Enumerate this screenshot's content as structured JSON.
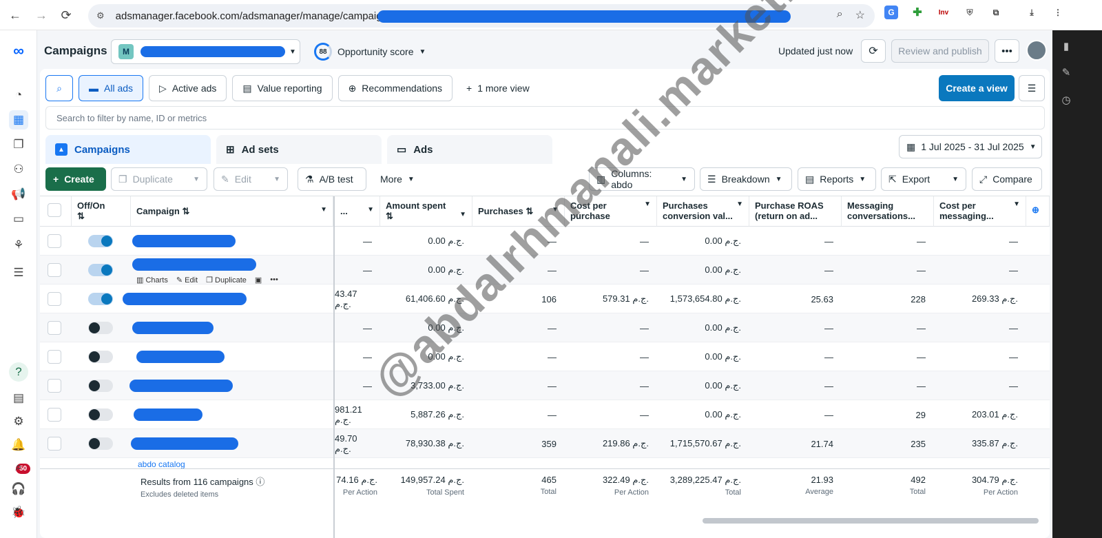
{
  "browser": {
    "url": "adsmanager.facebook.com/adsmanager/manage/campaigns"
  },
  "header": {
    "title": "Campaigns",
    "account_initial": "M",
    "opportunity_score": "88",
    "opportunity_label": "Opportunity score",
    "updated": "Updated just now",
    "review_publish": "Review and publish"
  },
  "views": {
    "all_ads": "All ads",
    "active_ads": "Active ads",
    "value_reporting": "Value reporting",
    "recommendations": "Recommendations",
    "more_view": "1 more view",
    "create_view": "Create a view"
  },
  "filter_placeholder": "Search to filter by name, ID or metrics",
  "tabs": {
    "campaigns": "Campaigns",
    "adsets": "Ad sets",
    "ads": "Ads"
  },
  "date_range": "1 Jul 2025 - 31 Jul 2025",
  "toolbar": {
    "create": "Create",
    "duplicate": "Duplicate",
    "edit": "Edit",
    "ab_test": "A/B test",
    "more": "More",
    "columns": "Columns: abdo",
    "breakdown": "Breakdown",
    "reports": "Reports",
    "export": "Export",
    "compare": "Compare"
  },
  "table": {
    "headers": {
      "offon": "Off/On",
      "campaign": "Campaign",
      "amount_spent": "Amount spent",
      "purchases": "Purchases",
      "cost_per_purchase": "Cost per purchase",
      "purchases_conv_value": "Purchases conversion val...",
      "purchase_roas": "Purchase ROAS (return on ad...",
      "messaging_conv": "Messaging conversations...",
      "cost_per_messaging": "Cost per messaging..."
    },
    "row_actions": {
      "charts": "Charts",
      "edit": "Edit",
      "duplicate": "Duplicate"
    },
    "rows": [
      {
        "on": true,
        "partial": "—",
        "spent": "0.00 ج.م.",
        "purchases": "—",
        "cpp": "—",
        "pcv": "0.00 ج.م.",
        "roas": "—",
        "msg": "—",
        "cpm": "—"
      },
      {
        "on": true,
        "partial": "—",
        "spent": "0.00 ج.م.",
        "purchases": "—",
        "cpp": "—",
        "pcv": "0.00 ج.م.",
        "roas": "—",
        "msg": "—",
        "cpm": "—"
      },
      {
        "on": true,
        "partial": "43.47 ج.م.",
        "spent": "61,406.60 ج.م.",
        "purchases": "106",
        "cpp": "579.31 ج.م.",
        "pcv": "1,573,654.80 ج.م.",
        "roas": "25.63",
        "msg": "228",
        "cpm": "269.33 ج.م."
      },
      {
        "on": false,
        "partial": "—",
        "spent": "0.00 ج.م.",
        "purchases": "—",
        "cpp": "—",
        "pcv": "0.00 ج.م.",
        "roas": "—",
        "msg": "—",
        "cpm": "—"
      },
      {
        "on": false,
        "partial": "—",
        "spent": "0.00 ج.م.",
        "purchases": "—",
        "cpp": "—",
        "pcv": "0.00 ج.م.",
        "roas": "—",
        "msg": "—",
        "cpm": "—"
      },
      {
        "on": false,
        "partial": "—",
        "spent": "3,733.00 ج.م.",
        "purchases": "—",
        "cpp": "—",
        "pcv": "0.00 ج.م.",
        "roas": "—",
        "msg": "—",
        "cpm": "—"
      },
      {
        "on": false,
        "partial": "981.21 ج.م.",
        "spent": "5,887.26 ج.م.",
        "purchases": "—",
        "cpp": "—",
        "pcv": "0.00 ج.م.",
        "roas": "—",
        "msg": "29",
        "cpm": "203.01 ج.م."
      },
      {
        "on": false,
        "partial": "49.70 ج.م.",
        "spent": "78,930.38 ج.م.",
        "purchases": "359",
        "cpp": "219.86 ج.م.",
        "pcv": "1,715,570.67 ج.م.",
        "roas": "21.74",
        "msg": "235",
        "cpm": "335.87 ج.م."
      }
    ],
    "partial_row_name": "abdo catalog",
    "totals": {
      "label": "Results from 116 campaigns",
      "sub": "Excludes deleted items",
      "partial": "74.16 ج.م.",
      "partial_sub": "Per Action",
      "spent": "149,957.24 ج.م.",
      "spent_sub": "Total Spent",
      "purchases": "465",
      "purchases_sub": "Total",
      "cpp": "322.49 ج.م.",
      "cpp_sub": "Per Action",
      "pcv": "3,289,225.47 ج.م.",
      "pcv_sub": "Total",
      "roas": "21.93",
      "roas_sub": "Average",
      "msg": "492",
      "msg_sub": "Total",
      "cpm": "304.79 ج.م.",
      "cpm_sub": "Per Action"
    }
  },
  "watermark": "@abdalrhmanali.marketing",
  "notifications": "50",
  "colors": {
    "brand_blue": "#0a78be",
    "create_green": "#1a6e4a",
    "redaction": "#1a6de6"
  }
}
